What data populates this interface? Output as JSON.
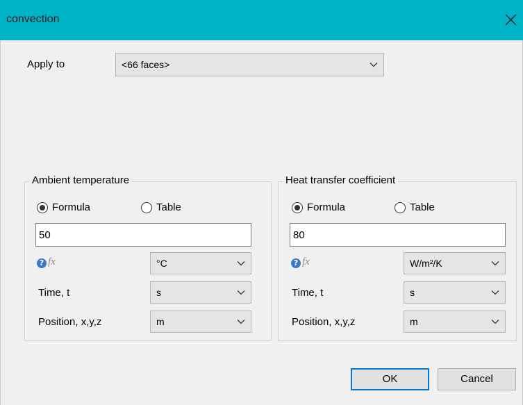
{
  "window": {
    "title": "convection",
    "titlebar_color": "#00b4c8",
    "close_icon": "close-icon"
  },
  "apply_to": {
    "label": "Apply to",
    "value": "<66 faces>"
  },
  "ambient": {
    "title": "Ambient temperature",
    "formula_label": "Formula",
    "table_label": "Table",
    "selected_mode": "Formula",
    "value": "50",
    "unit": "°C",
    "time_label": "Time, t",
    "time_unit": "s",
    "position_label": "Position, x,y,z",
    "position_unit": "m"
  },
  "htc": {
    "title": "Heat transfer coefficient",
    "formula_label": "Formula",
    "table_label": "Table",
    "selected_mode": "Formula",
    "value": "80",
    "unit": "W/m²/K",
    "time_label": "Time, t",
    "time_unit": "s",
    "position_label": "Position, x,y,z",
    "position_unit": "m"
  },
  "fx_label": "fx",
  "help_glyph": "?",
  "buttons": {
    "ok": "OK",
    "cancel": "Cancel"
  }
}
